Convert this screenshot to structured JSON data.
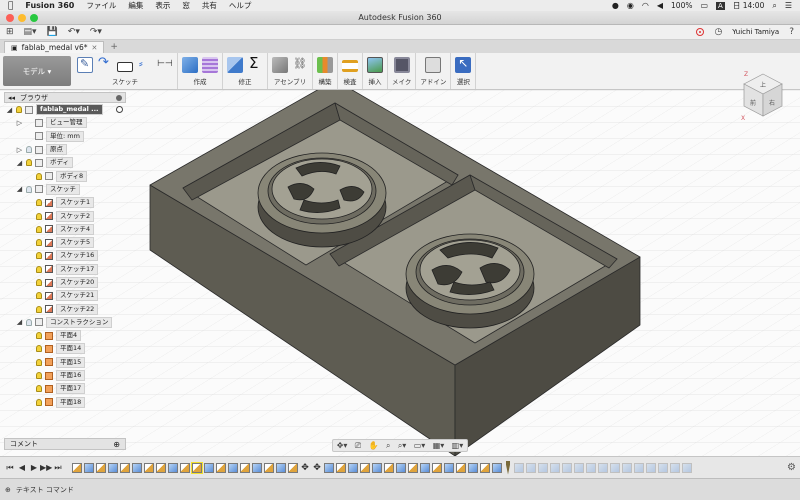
{
  "menubar": {
    "app_name": "Fusion 360",
    "items": [
      "ファイル",
      "編集",
      "表示",
      "窓",
      "共有",
      "ヘルプ"
    ],
    "status": {
      "battery": "100%",
      "time": "日 14:00",
      "input_method": "A"
    }
  },
  "window": {
    "title": "Autodesk Fusion 360"
  },
  "quickbar": {
    "user": "Yuichi Tamiya",
    "help": "?"
  },
  "tab": {
    "name": "fablab_medal v6*",
    "add": "+"
  },
  "ribbon": {
    "workspace": "モデル",
    "groups": [
      {
        "label": "スケッチ"
      },
      {
        "label": "作成"
      },
      {
        "label": "修正"
      },
      {
        "label": "アセンブリ"
      },
      {
        "label": "構築"
      },
      {
        "label": "検査"
      },
      {
        "label": "挿入"
      },
      {
        "label": "メイク"
      },
      {
        "label": "アドイン"
      },
      {
        "label": "選択"
      }
    ]
  },
  "browser": {
    "title": "ブラウザ",
    "nodes": [
      {
        "label": "fablab_medal ...",
        "root": true
      },
      {
        "label": "ビュー管理"
      },
      {
        "label": "単位: mm"
      },
      {
        "label": "原点"
      },
      {
        "label": "ボディ"
      },
      {
        "label": "ボディ8"
      },
      {
        "label": "スケッチ"
      },
      {
        "label": "スケッチ1"
      },
      {
        "label": "スケッチ2"
      },
      {
        "label": "スケッチ4"
      },
      {
        "label": "スケッチ5"
      },
      {
        "label": "スケッチ16"
      },
      {
        "label": "スケッチ17"
      },
      {
        "label": "スケッチ20"
      },
      {
        "label": "スケッチ21"
      },
      {
        "label": "スケッチ22"
      },
      {
        "label": "コンストラクション"
      },
      {
        "label": "平面4"
      },
      {
        "label": "平面14"
      },
      {
        "label": "平面15"
      },
      {
        "label": "平面16"
      },
      {
        "label": "平面17"
      },
      {
        "label": "平面18"
      }
    ]
  },
  "comments": {
    "label": "コメント"
  },
  "viewcube": {
    "top": "上",
    "front": "前",
    "right": "右",
    "axis_x": "X",
    "axis_z": "Z"
  },
  "cmdbar": {
    "label": "テキスト コマンド"
  }
}
